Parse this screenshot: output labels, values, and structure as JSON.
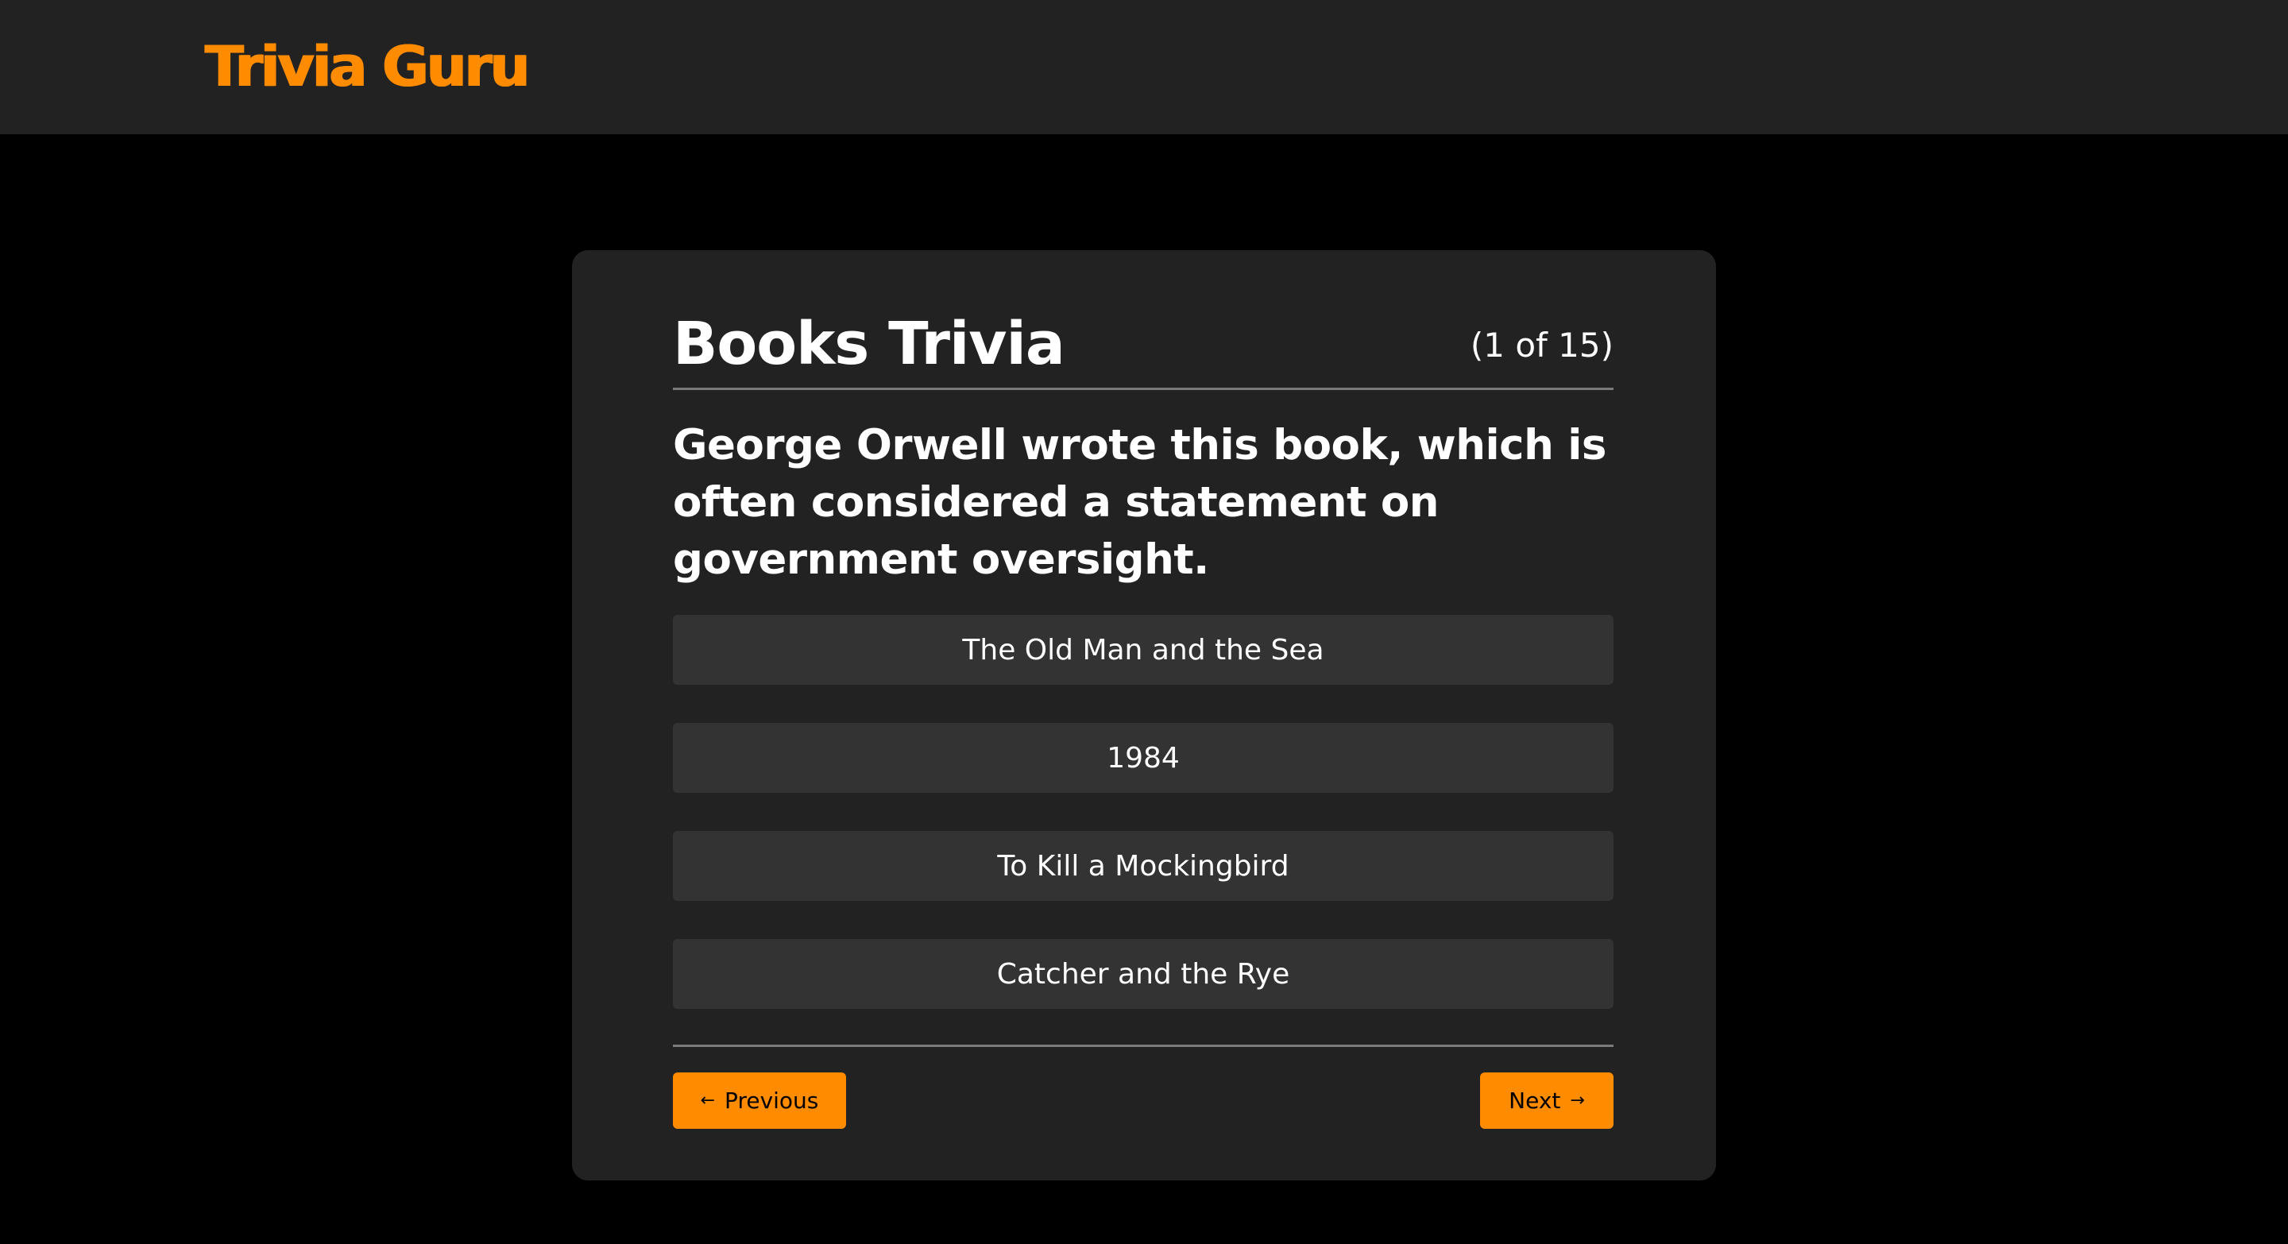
{
  "header": {
    "brand": "Trivia Guru"
  },
  "quiz": {
    "title": "Books Trivia",
    "counter": "(1 of 15)",
    "question": "George Orwell wrote this book, which is often considered a statement on government oversight.",
    "answers": [
      "The Old Man and the Sea",
      "1984",
      "To Kill a Mockingbird",
      "Catcher and the Rye"
    ]
  },
  "nav": {
    "previous_label": "Previous",
    "next_label": "Next",
    "previous_icon": "arrow-left-icon",
    "next_icon": "arrow-right-icon"
  },
  "colors": {
    "accent": "#ff8c00",
    "background": "#000000",
    "surface": "#222222",
    "answer_bg": "#333333",
    "text": "#ffffff"
  }
}
